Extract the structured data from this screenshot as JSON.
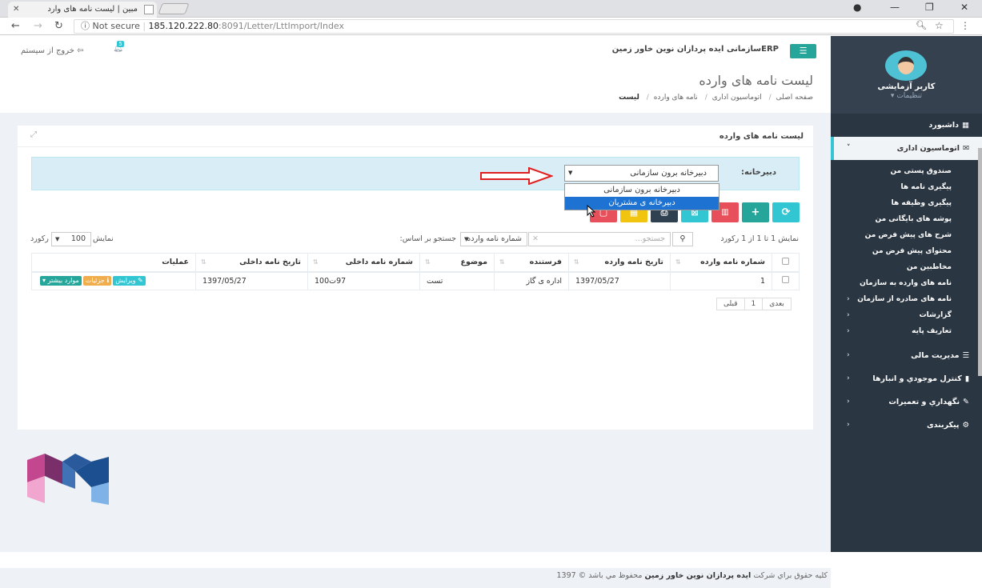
{
  "browser": {
    "tab_title": "مبین | لیست نامه های وارد",
    "url_warning": "Not secure",
    "url_host": "185.120.222.80",
    "url_rest": ":8091/Letter/LttImport/Index"
  },
  "header": {
    "app_title": "ERPسازمانی ایده پردازان نوین خاور زمین",
    "logout": "خروج از سیستم",
    "bell_count": "5"
  },
  "page": {
    "title": "لیست نامه های وارده",
    "breadcrumb": [
      "صفحه اصلی",
      "اتوماسیون اداری",
      "نامه های وارده",
      "لیست"
    ]
  },
  "sidebar": {
    "user_name": "کاربر آزمایشی",
    "user_settings": "تنظیمات",
    "items": [
      {
        "label": "داشبورد",
        "icon": "grid-icon"
      },
      {
        "label": "اتوماسیون اداری",
        "icon": "envelope-icon"
      },
      {
        "label": "مدیریت مالی",
        "icon": "bars-icon"
      },
      {
        "label": "کنترل موجودي و انبارها",
        "icon": "chart-icon"
      },
      {
        "label": "نگهداري و تعميرات",
        "icon": "wrench-icon"
      },
      {
        "label": "پیکربندی",
        "icon": "cogs-icon"
      }
    ],
    "subitems": [
      "صندوق پستی من",
      "پیگیری نامه ها",
      "پیگیری وظیفه ها",
      "پوشه های بایگانی من",
      "شرح های پیش فرض من",
      "محتوای پیش فرض من",
      "مخاطبین من",
      "نامه های وارده به سازمان",
      "نامه های صادره از سازمان",
      "گزارشات",
      "تعاریف پایه"
    ]
  },
  "portlet": {
    "title": "لیست نامه های وارده",
    "filter_label": "دبیرخانه:",
    "select_value": "دبیرخانه برون سازمانی",
    "dropdown_options": [
      "دبیرخانه برون سازمانی",
      "دبیرخانه ی مشتریان"
    ],
    "show_info": "نمایش 1 تا 1 از 1 رکورد",
    "search_by": "جستجو بر اساس:",
    "search_field": "شماره نامه وارده",
    "search_placeholder": "جستجو...",
    "len_label": "نمایش",
    "len_value": "100",
    "len_suffix": "رکورد",
    "columns": [
      "شماره نامه وارده",
      "تاریخ نامه وارده",
      "فرستنده",
      "موضوع",
      "شماره نامه داخلی",
      "تاریخ نامه داخلی",
      "عملیات"
    ],
    "rows": [
      {
        "no": "1",
        "date": "1397/05/27",
        "sender": "اداره ی گاز",
        "subject": "تست",
        "internal_no": "97ت100",
        "internal_date": "1397/05/27"
      }
    ],
    "actions": {
      "edit": "ویرایش",
      "details": "جزئیات",
      "more": "موارد بیشتر"
    },
    "pager": {
      "prev": "قبلی",
      "page": "1",
      "next": "بعدی"
    }
  },
  "footer": {
    "prefix": "کلیه حقوق براي شرکت",
    "company": "ایده پردازان نوین خاور زمین",
    "suffix": "محفوظ مي باشد © 1397"
  },
  "colors": {
    "sidebar": "#2b3643",
    "accent": "#36c6d3",
    "green": "#26a69a"
  }
}
